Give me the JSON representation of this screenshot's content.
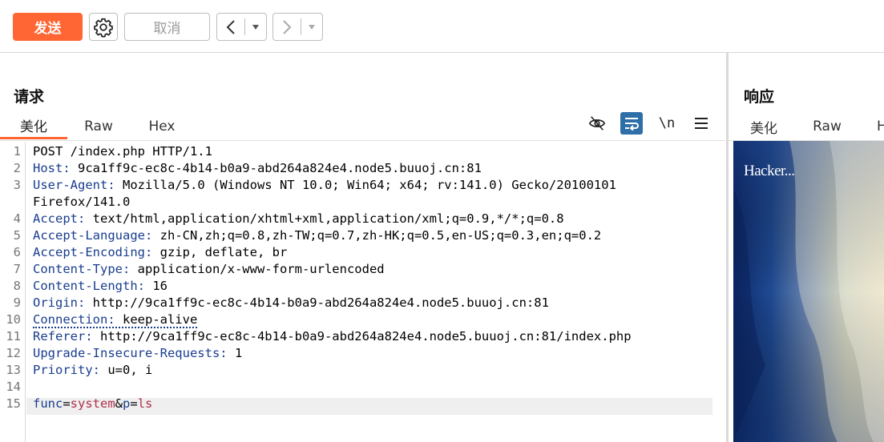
{
  "toolbar": {
    "send_label": "发送",
    "settings_icon": "gear-icon",
    "cancel_label": "取消",
    "prev_icon": "chevron-left-icon",
    "next_icon": "chevron-right-icon",
    "dropdown_icon": "caret-down-icon",
    "send_color": "#ff6633"
  },
  "request": {
    "title": "请求",
    "tabs": [
      "美化",
      "Raw",
      "Hex"
    ],
    "active_tab": "美化",
    "tools": {
      "hide_icon": "eye-off-icon",
      "wrap_icon": "word-wrap-icon",
      "newline_label": "\\n",
      "menu_icon": "hamburger-menu-icon"
    },
    "lines": [
      {
        "num": "1",
        "text": "POST /index.php HTTP/1.1"
      },
      {
        "num": "2",
        "key": "Host",
        "value": " 9ca1ff9c-ec8c-4b14-b0a9-abd264a824e4.node5.buuoj.cn:81"
      },
      {
        "num": "3",
        "key": "User-Agent",
        "value": " Mozilla/5.0 (Windows NT 10.0; Win64; x64; rv:141.0) Gecko/20100101"
      },
      {
        "num": "",
        "text": "Firefox/141.0"
      },
      {
        "num": "4",
        "key": "Accept",
        "value": " text/html,application/xhtml+xml,application/xml;q=0.9,*/*;q=0.8"
      },
      {
        "num": "5",
        "key": "Accept-Language",
        "value": " zh-CN,zh;q=0.8,zh-TW;q=0.7,zh-HK;q=0.5,en-US;q=0.3,en;q=0.2"
      },
      {
        "num": "6",
        "key": "Accept-Encoding",
        "value": " gzip, deflate, br"
      },
      {
        "num": "7",
        "key": "Content-Type",
        "value": " application/x-www-form-urlencoded"
      },
      {
        "num": "8",
        "key": "Content-Length",
        "value": " 16"
      },
      {
        "num": "9",
        "key": "Origin",
        "value": " http://9ca1ff9c-ec8c-4b14-b0a9-abd264a824e4.node5.buuoj.cn:81"
      },
      {
        "num": "10",
        "key": "Connection",
        "value": " keep-alive"
      },
      {
        "num": "11",
        "key": "Referer",
        "value": " http://9ca1ff9c-ec8c-4b14-b0a9-abd264a824e4.node5.buuoj.cn:81/index.php"
      },
      {
        "num": "12",
        "key": "Upgrade-Insecure-Requests",
        "value": " 1"
      },
      {
        "num": "13",
        "key": "Priority",
        "value": " u=0, i"
      },
      {
        "num": "14",
        "text": ""
      },
      {
        "num": "15",
        "body": {
          "k1": "func",
          "v1": "system",
          "k2": "p",
          "v2": "ls"
        }
      }
    ]
  },
  "response": {
    "title": "响应",
    "tabs": [
      "美化",
      "Raw",
      "H"
    ],
    "render_text": "Hacker..."
  }
}
